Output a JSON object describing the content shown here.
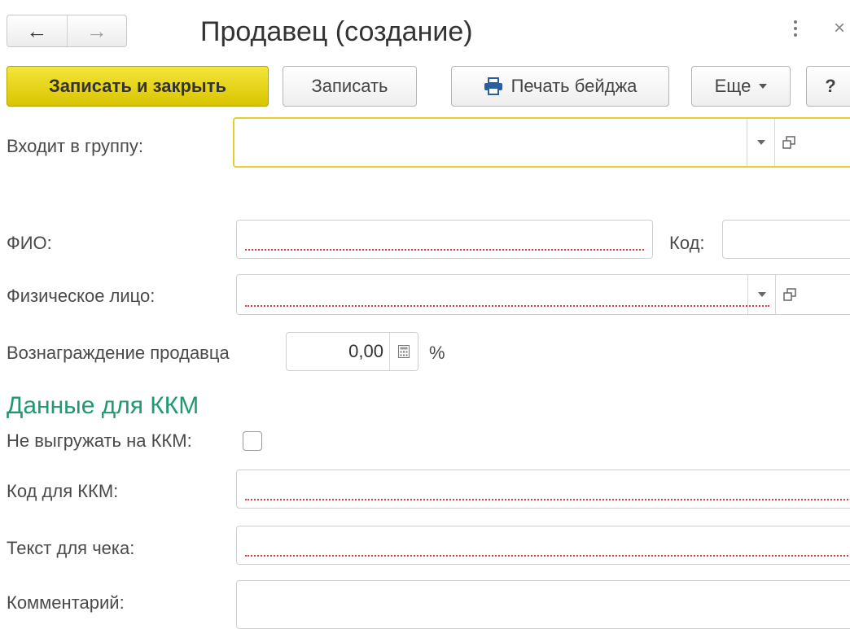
{
  "window": {
    "title": "Продавец (создание)",
    "back_icon": "←",
    "forward_icon": "→",
    "close_icon": "×"
  },
  "toolbar": {
    "save_close_label": "Записать и закрыть",
    "save_label": "Записать",
    "print_badge_label": "Печать бейджа",
    "more_label": "Еще",
    "help_label": "?"
  },
  "form": {
    "group_label": "Входит в группу:",
    "fio_label": "ФИО:",
    "code_label": "Код:",
    "person_label": "Физическое лицо:",
    "reward_label": "Вознаграждение продавца",
    "reward_value": "0,00",
    "reward_unit": "%"
  },
  "kkm": {
    "section_title": "Данные для ККМ",
    "no_export_label": "Не выгружать на ККМ:",
    "kkm_code_label": "Код для ККМ:",
    "receipt_text_label": "Текст для чека:",
    "comment_label": "Комментарий:"
  },
  "colors": {
    "accent_yellow": "#e6cf2e",
    "section_green": "#1f9a6e",
    "required_red": "#e53b3b"
  }
}
